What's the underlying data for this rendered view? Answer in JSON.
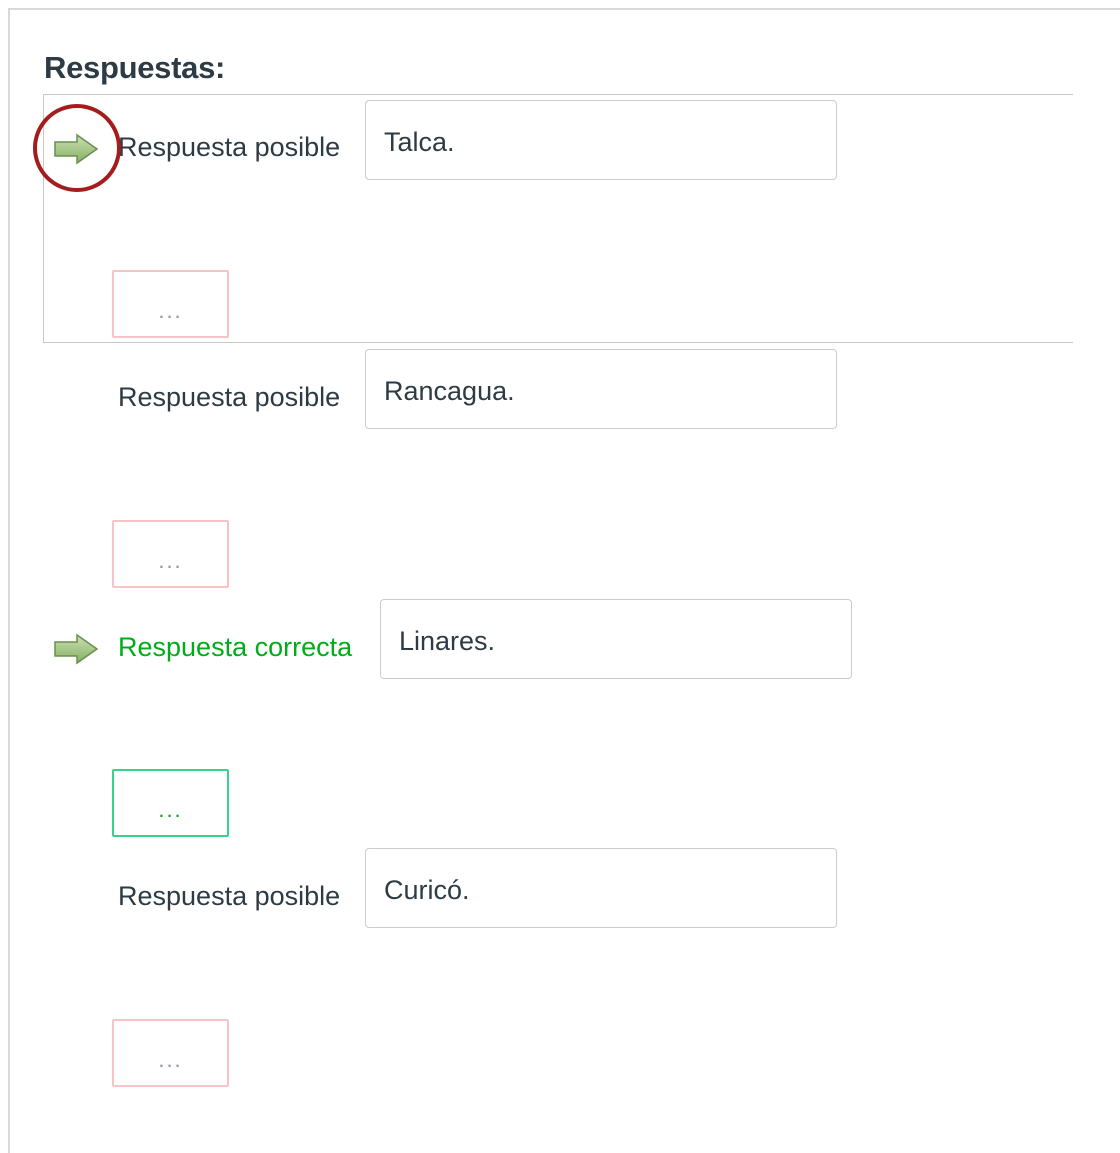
{
  "heading": "Respuestas:",
  "answers": [
    {
      "label": "Respuesta posible",
      "value": "Talca.",
      "comment": "...",
      "correct": false,
      "selected": true
    },
    {
      "label": "Respuesta posible",
      "value": "Rancagua.",
      "comment": "...",
      "correct": false,
      "selected": false
    },
    {
      "label": "Respuesta correcta",
      "value": "Linares.",
      "comment": "...",
      "correct": true,
      "selected": false
    },
    {
      "label": "Respuesta posible",
      "value": "Curicó.",
      "comment": "...",
      "correct": false,
      "selected": false
    }
  ],
  "icons": {
    "arrow": "right-arrow-icon",
    "highlight": "red-circle-annotation"
  },
  "colors": {
    "heading": "#2d3b45",
    "correct": "#00ac18",
    "arrow_fill": "#9bc27a",
    "highlight": "#a51c1c",
    "comment_border": "#f6c4c4",
    "comment_border_correct": "#3ad18a"
  }
}
